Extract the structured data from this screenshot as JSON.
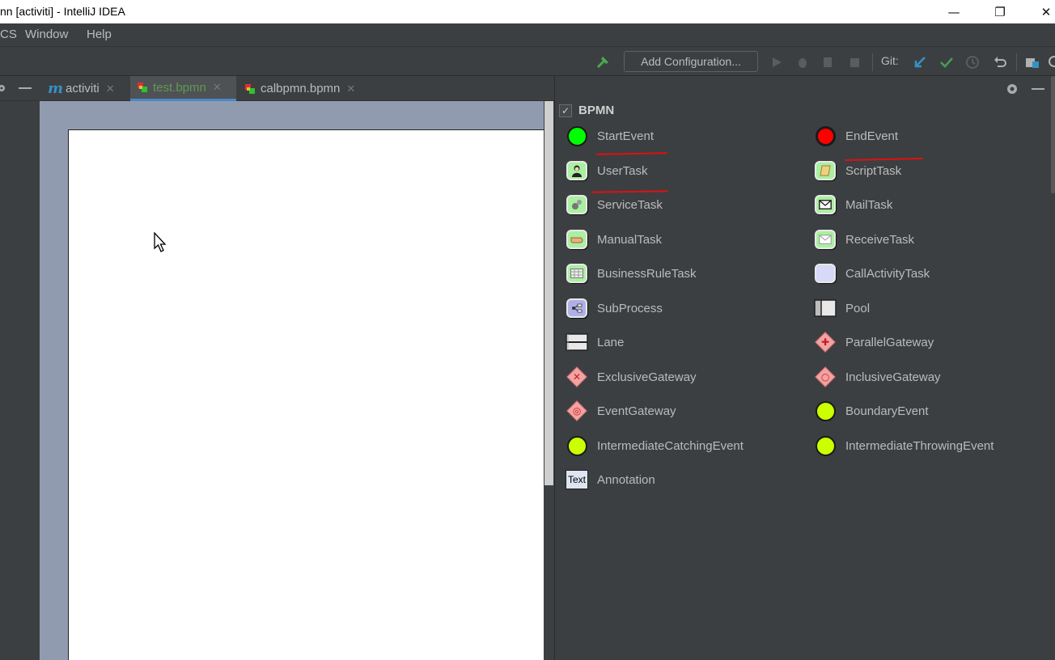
{
  "window": {
    "title": "nn [activiti] - IntelliJ IDEA",
    "minimize_glyph": "—",
    "restore_glyph": "❐",
    "close_glyph": "✕"
  },
  "menu": {
    "items": [
      "CS",
      "Window",
      "Help"
    ]
  },
  "toolbar": {
    "add_configuration": "Add Configuration...",
    "git_label": "Git:",
    "icons": [
      "hammer-icon",
      "run-icon",
      "debug-icon",
      "coverage-icon",
      "stop-icon",
      "git-update-icon",
      "git-commit-icon",
      "git-history-icon",
      "git-revert-icon",
      "project-structure-icon"
    ]
  },
  "tabs": [
    {
      "icon": "m",
      "label": "activiti",
      "active": false
    },
    {
      "icon": "bpmn",
      "label": "test.bpmn",
      "active": true
    },
    {
      "icon": "bpmn",
      "label": "calbpmn.bpmn",
      "active": false
    }
  ],
  "palette": {
    "group": "BPMN",
    "group_checked": true,
    "items": [
      {
        "label": "StartEvent",
        "icon": "start-event-icon"
      },
      {
        "label": "EndEvent",
        "icon": "end-event-icon"
      },
      {
        "label": "UserTask",
        "icon": "user-task-icon"
      },
      {
        "label": "ScriptTask",
        "icon": "script-task-icon"
      },
      {
        "label": "ServiceTask",
        "icon": "service-task-icon"
      },
      {
        "label": "MailTask",
        "icon": "mail-task-icon"
      },
      {
        "label": "ManualTask",
        "icon": "manual-task-icon"
      },
      {
        "label": "ReceiveTask",
        "icon": "receive-task-icon"
      },
      {
        "label": "BusinessRuleTask",
        "icon": "business-rule-task-icon"
      },
      {
        "label": "CallActivityTask",
        "icon": "call-activity-task-icon"
      },
      {
        "label": "SubProcess",
        "icon": "subprocess-icon"
      },
      {
        "label": "Pool",
        "icon": "pool-icon"
      },
      {
        "label": "Lane",
        "icon": "lane-icon"
      },
      {
        "label": "ParallelGateway",
        "icon": "parallel-gateway-icon"
      },
      {
        "label": "ExclusiveGateway",
        "icon": "exclusive-gateway-icon"
      },
      {
        "label": "InclusiveGateway",
        "icon": "inclusive-gateway-icon"
      },
      {
        "label": "EventGateway",
        "icon": "event-gateway-icon"
      },
      {
        "label": "BoundaryEvent",
        "icon": "boundary-event-icon"
      },
      {
        "label": "IntermediateCatchingEvent",
        "icon": "intermediate-catching-event-icon"
      },
      {
        "label": "IntermediateThrowingEvent",
        "icon": "intermediate-throwing-event-icon"
      },
      {
        "label": "Annotation",
        "icon": "annotation-icon",
        "icon_text": "Text"
      }
    ]
  },
  "colors": {
    "start_event": "#00ff00",
    "end_event": "#ff0000",
    "event_green": "#ccff00",
    "task_green": "#a9f0a0",
    "gateway_pink": "#f2a3a3",
    "active_tab_text": "#629755",
    "annotation_red": "#e01010"
  }
}
